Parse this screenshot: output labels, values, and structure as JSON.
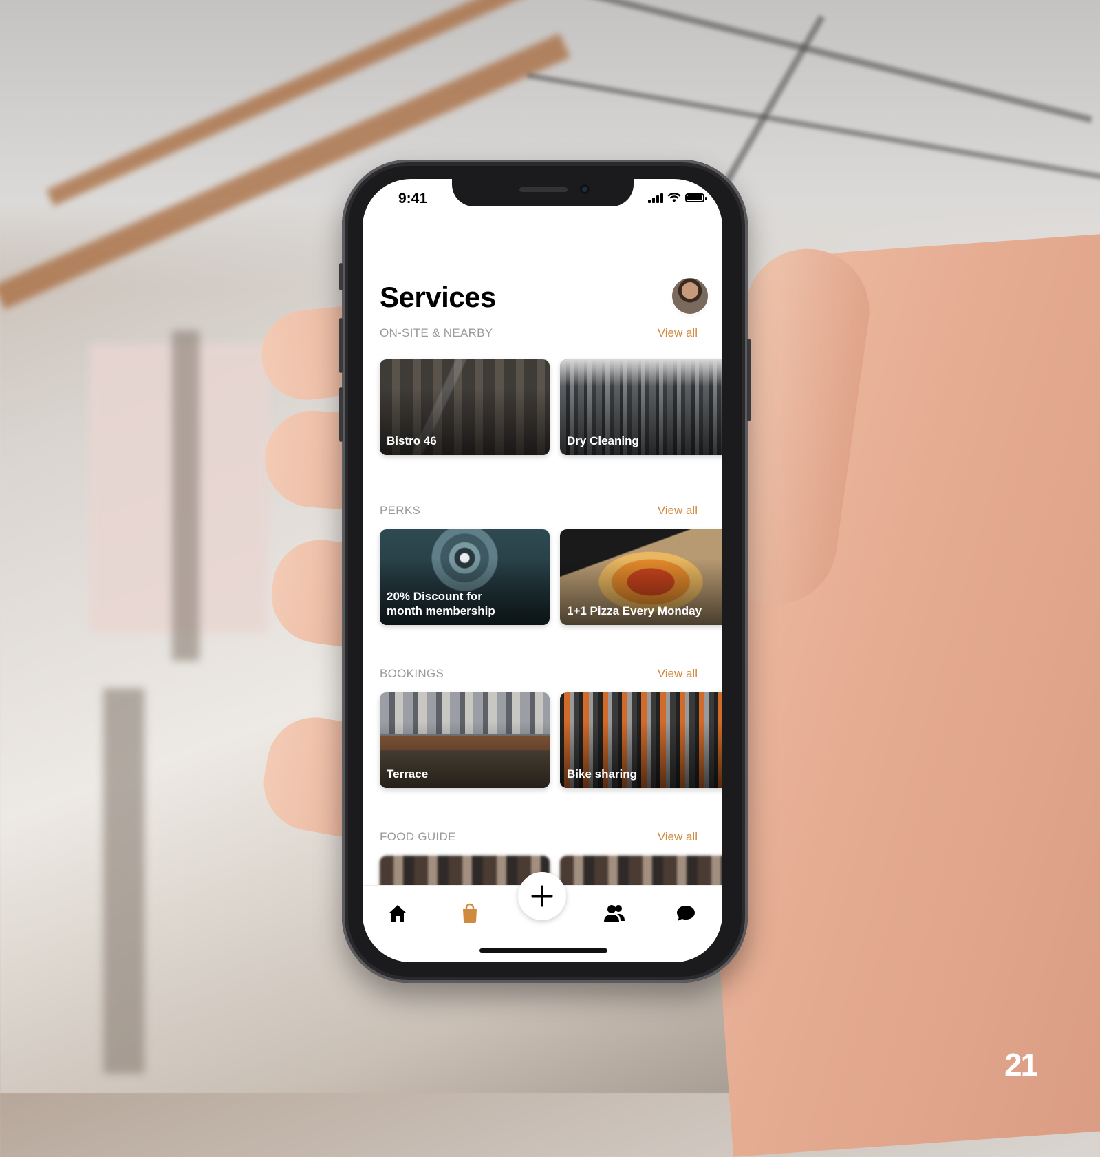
{
  "status_bar": {
    "time": "9:41"
  },
  "header": {
    "title": "Services"
  },
  "sections": [
    {
      "label": "ON-SITE & NEARBY",
      "view_all": "View all",
      "cards": [
        {
          "label_lines": [
            "Bistro 46"
          ]
        },
        {
          "label_lines": [
            "Dry Cleaning"
          ]
        }
      ]
    },
    {
      "label": "PERKS",
      "view_all": "View all",
      "cards": [
        {
          "label_lines": [
            "20% Discount for",
            "month membership"
          ]
        },
        {
          "label_lines": [
            "1+1 Pizza Every Monday"
          ]
        }
      ]
    },
    {
      "label": "BOOKINGS",
      "view_all": "View all",
      "cards": [
        {
          "label_lines": [
            "Terrace"
          ]
        },
        {
          "label_lines": [
            "Bike sharing"
          ]
        }
      ]
    },
    {
      "label": "FOOD GUIDE",
      "view_all": "View all",
      "cards": []
    }
  ],
  "tab_bar": {
    "items": [
      {
        "icon": "home-icon",
        "active": false
      },
      {
        "icon": "shopping-bag-icon",
        "active": true
      },
      {
        "icon": "plus-icon",
        "active": false
      },
      {
        "icon": "people-icon",
        "active": false
      },
      {
        "icon": "chat-bubble-icon",
        "active": false
      }
    ]
  },
  "colors": {
    "accent": "#d08a3e",
    "section_label": "#9a9a9a",
    "title": "#000000"
  },
  "page_number": "21"
}
